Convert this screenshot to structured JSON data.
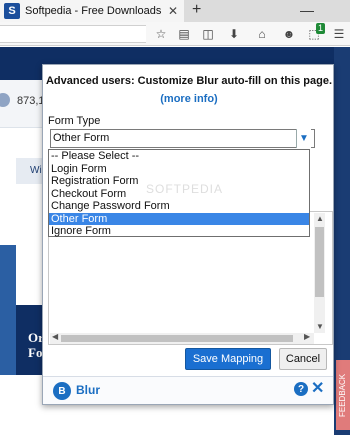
{
  "browser": {
    "tab_title": "Softpedia - Free Downloads Encyc…",
    "tab_favicon": "S",
    "close_tab": "✕",
    "new_tab": "+",
    "minimize": "—",
    "toolbar_icons": [
      "star-icon",
      "reading-list-icon",
      "pocket-icon",
      "download-icon",
      "home-icon",
      "emoji-icon",
      "extension-icon",
      "menu-icon"
    ],
    "extension_badge": "1"
  },
  "background_page": {
    "download_count": "873,1",
    "wi_fragment": "Wi",
    "headline_fragment": "Or\nFo",
    "feedback_label": "FEEDBACK"
  },
  "popup": {
    "heading": "Advanced users: Customize Blur auto-fill on this page.",
    "more_info": "(more info)",
    "form_type_label": "Form Type",
    "selected_value": "Other Form",
    "options": [
      "-- Please Select --",
      "Login Form",
      "Registration Form",
      "Checkout Form",
      "Change Password Form",
      "Other Form",
      "Ignore Form"
    ],
    "highlighted_option_index": 5,
    "watermark": "SOFTPEDIA",
    "save_button": "Save Mapping",
    "cancel_button": "Cancel",
    "brand_name": "Blur",
    "brand_logo": "B",
    "help_icon": "?",
    "close_icon": "✕"
  },
  "colors": {
    "accent": "#1b6ec2",
    "selected_option": "#3a86e6",
    "site_header": "#0f2e63"
  }
}
